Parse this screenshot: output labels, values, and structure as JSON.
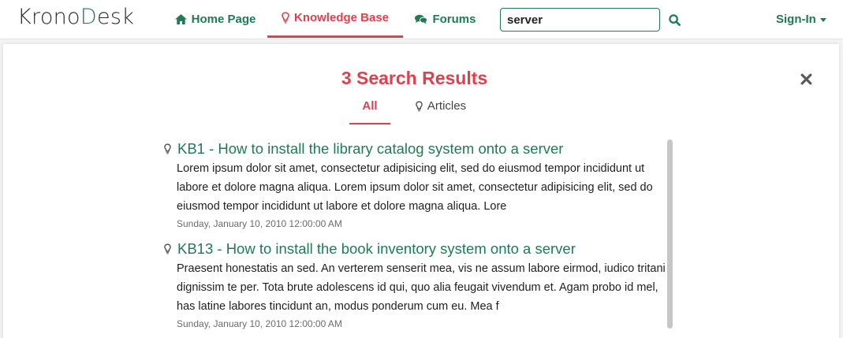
{
  "brand": {
    "logo_main": "Krono",
    "logo_accent": "D",
    "logo_tail": "esk"
  },
  "nav": {
    "home_label": "Home Page",
    "knowledge_base_label": "Knowledge Base",
    "forums_label": "Forums",
    "signin_label": "Sign-In"
  },
  "search": {
    "value": "server"
  },
  "results": {
    "title": "3 Search Results",
    "tabs": {
      "all_label": "All",
      "articles_label": "Articles"
    },
    "items": [
      {
        "title": "KB1 - How to install the library catalog system onto a server",
        "summary": "Lorem ipsum dolor sit amet, consectetur adipisicing elit, sed do eiusmod tempor incididunt ut labore et dolore magna aliqua. Lorem ipsum dolor sit amet, consectetur adipisicing elit, sed do eiusmod tempor incididunt ut labore et dolore magna aliqua. Lore",
        "date": "Sunday, January 10, 2010 12:00:00 AM"
      },
      {
        "title": "KB13 - How to install the book inventory system onto a server",
        "summary": "Praesent honestatis an sed. An verterem senserit mea, vis ne assum labore eirmod, iudico tritani dignissim te per. Tota brute adolescens id qui, quo alia feugait vivendum et. Agam probo id mel, has latine labores tincidunt an, modus ponderum cum eu. Mea f",
        "date": "Sunday, January 10, 2010 12:00:00 AM"
      }
    ]
  },
  "colors": {
    "brand_green": "#1f7a55",
    "accent_red": "#e0404d"
  },
  "icons": {
    "home": "home-icon",
    "knowledge_base": "lightbulb-icon",
    "forums": "comments-icon",
    "search": "search-icon",
    "close": "close-icon",
    "article": "lightbulb-icon"
  }
}
